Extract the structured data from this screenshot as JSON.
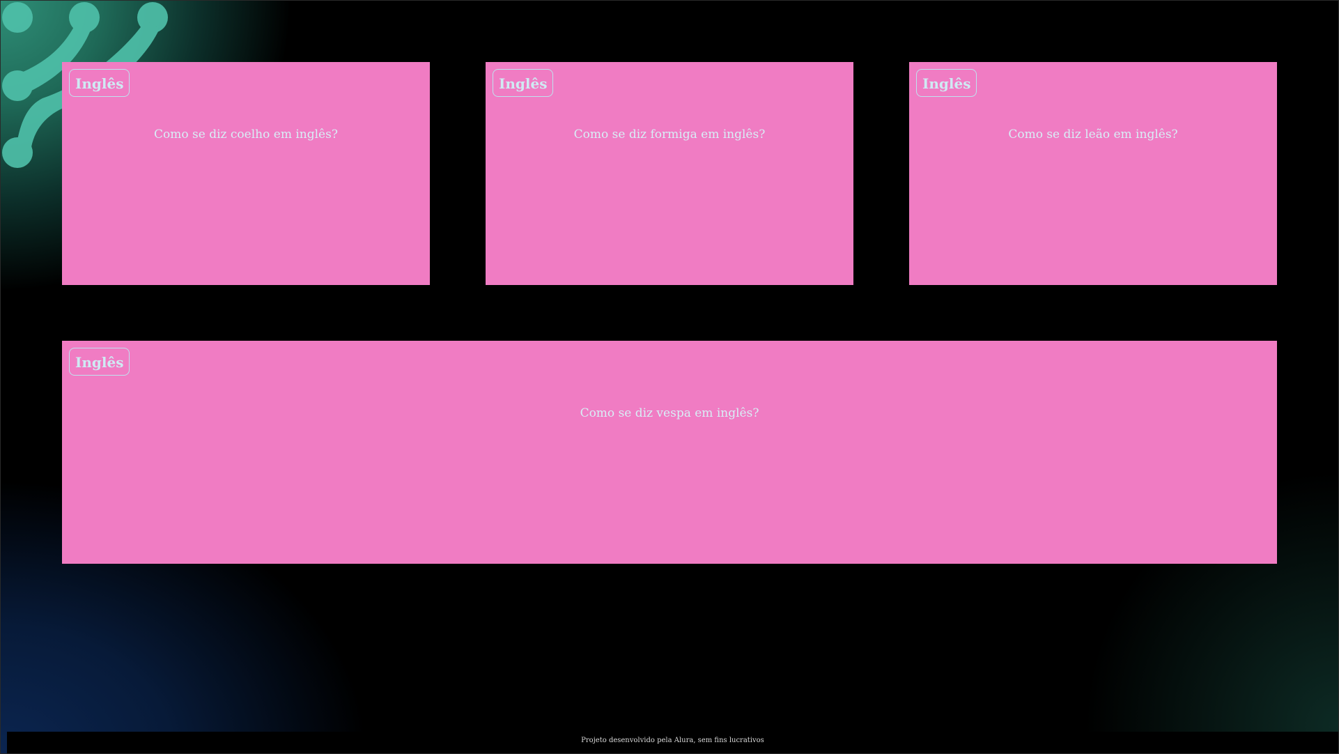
{
  "cards": [
    {
      "tag": "Inglês",
      "question": "Como se diz coelho em inglês?"
    },
    {
      "tag": "Inglês",
      "question": "Como se diz formiga em inglês?"
    },
    {
      "tag": "Inglês",
      "question": "Como se diz leão em inglês?"
    },
    {
      "tag": "Inglês",
      "question": "Como se diz vespa em inglês?"
    }
  ],
  "footer": {
    "text": "Projeto desenvolvido pela Alura, sem fins lucrativos"
  },
  "colors": {
    "card": "#f07cc3",
    "background": "#000000",
    "accent": "#4fc1aa"
  }
}
